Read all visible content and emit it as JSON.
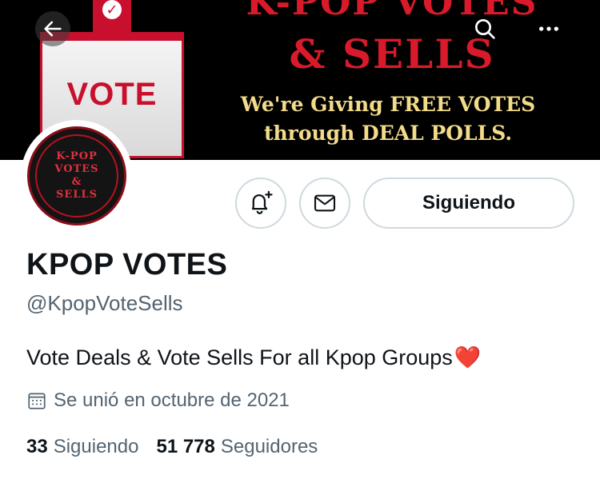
{
  "banner": {
    "ballot_label": "VOTE",
    "title_top": "K-POP VOTES",
    "title": "& SELLS",
    "subtitle_line1": "We're Giving FREE VOTES",
    "subtitle_line2": "through DEAL POLLS."
  },
  "avatar": {
    "line1": "K-POP",
    "line2": "VOTES",
    "line3": "&",
    "line4": "SELLS"
  },
  "icons": {
    "back": "back-arrow-icon",
    "search": "search-icon",
    "more": "more-options-icon",
    "notifications": "bell-plus-icon",
    "message": "mail-icon",
    "calendar": "calendar-icon",
    "heart": "red-heart-emoji"
  },
  "actions": {
    "following_label": "Siguiendo"
  },
  "profile": {
    "display_name": "KPOP VOTES",
    "handle": "@KpopVoteSells",
    "bio": "Vote Deals & Vote Sells For all Kpop Groups",
    "bio_emoji": "❤️",
    "joined": "Se unió en octubre de 2021"
  },
  "stats": {
    "following_count": "33",
    "following_label": "Siguiendo",
    "followers_count": "51 778",
    "followers_label": "Seguidores"
  },
  "colors": {
    "banner_red": "#d91a2a",
    "banner_gold": "#f2dc8a",
    "text_primary": "#0f1419",
    "text_secondary": "#536471",
    "border": "#cfd9de"
  }
}
